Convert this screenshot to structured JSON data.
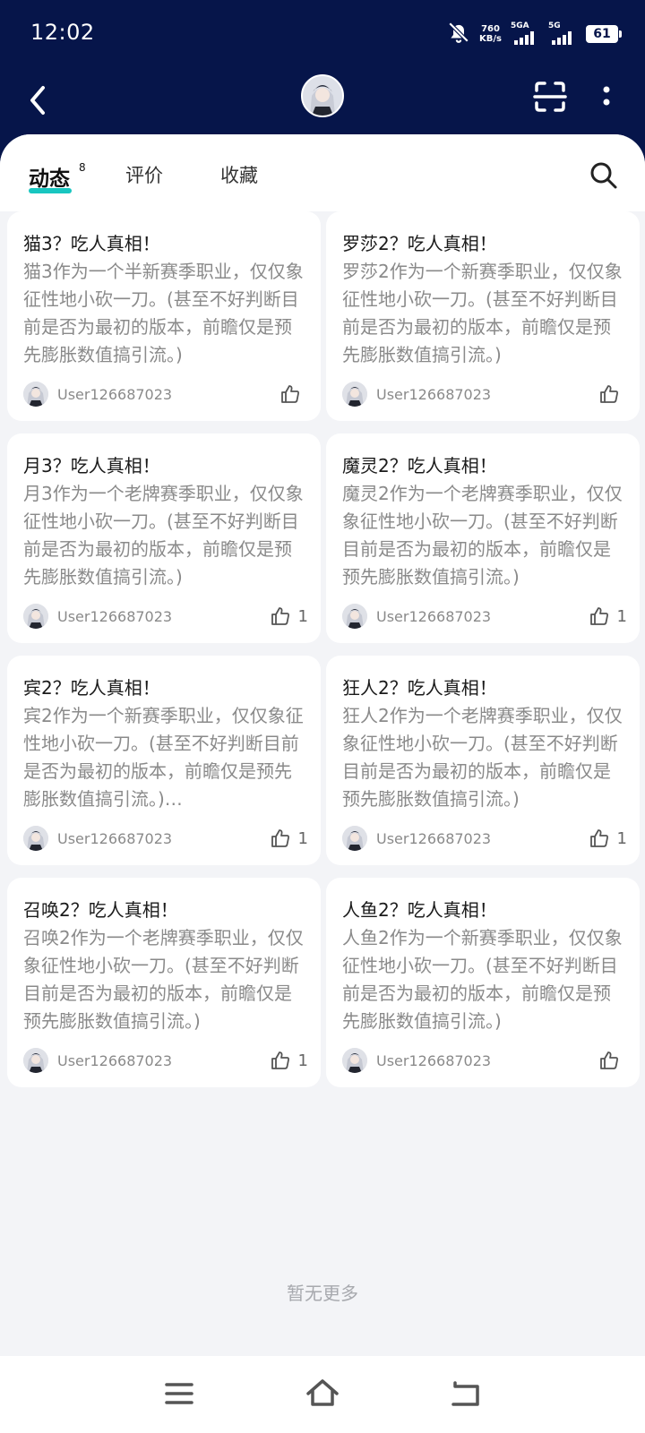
{
  "status_bar": {
    "time": "12:02",
    "speed_value": "760",
    "speed_unit": "KB/s",
    "sim1_label": "5GA",
    "sim2_label": "5G",
    "battery": "61"
  },
  "tabs": [
    {
      "label": "动态",
      "badge": "8",
      "active": true
    },
    {
      "label": "评价",
      "active": false
    },
    {
      "label": "收藏",
      "active": false
    }
  ],
  "posts": [
    {
      "title": "猫3？吃人真相！",
      "body": "猫3作为一个半新赛季职业，仅仅象征性地小砍一刀。(甚至不好判断目前是否为最初的版本，前瞻仅是预先膨胀数值搞引流。)",
      "user": "User126687023",
      "likes": ""
    },
    {
      "title": "罗莎2？吃人真相！",
      "body": "罗莎2作为一个新赛季职业，仅仅象征性地小砍一刀。(甚至不好判断目前是否为最初的版本，前瞻仅是预先膨胀数值搞引流。)",
      "user": "User126687023",
      "likes": ""
    },
    {
      "title": "月3？吃人真相！",
      "body": "月3作为一个老牌赛季职业，仅仅象征性地小砍一刀。(甚至不好判断目前是否为最初的版本，前瞻仅是预先膨胀数值搞引流。)",
      "user": "User126687023",
      "likes": "1"
    },
    {
      "title": "魔灵2？吃人真相！",
      "body": "魔灵2作为一个老牌赛季职业，仅仅象征性地小砍一刀。(甚至不好判断目前是否为最初的版本，前瞻仅是预先膨胀数值搞引流。)",
      "user": "User126687023",
      "likes": "1"
    },
    {
      "title": "宾2？吃人真相！",
      "body": "宾2作为一个新赛季职业，仅仅象征性地小砍一刀。(甚至不好判断目前是否为最初的版本，前瞻仅是预先膨胀数值搞引流。)…",
      "user": "User126687023",
      "likes": "1"
    },
    {
      "title": "狂人2？吃人真相！",
      "body": "狂人2作为一个老牌赛季职业，仅仅象征性地小砍一刀。(甚至不好判断目前是否为最初的版本，前瞻仅是预先膨胀数值搞引流。)",
      "user": "User126687023",
      "likes": "1"
    },
    {
      "title": "召唤2？吃人真相！",
      "body": "召唤2作为一个老牌赛季职业，仅仅象征性地小砍一刀。(甚至不好判断目前是否为最初的版本，前瞻仅是预先膨胀数值搞引流。)",
      "user": "User126687023",
      "likes": "1"
    },
    {
      "title": "人鱼2？吃人真相！",
      "body": "人鱼2作为一个新赛季职业，仅仅象征性地小砍一刀。(甚至不好判断目前是否为最初的版本，前瞻仅是预先膨胀数值搞引流。)",
      "user": "User126687023",
      "likes": ""
    }
  ],
  "footer_text": "暂无更多",
  "colors": {
    "header_bg": "#06154a",
    "accent": "#18c6c0",
    "page_bg": "#f3f4f7"
  },
  "icons": {
    "back": "chevron-left-icon",
    "scan": "scan-icon",
    "more": "more-vertical-icon",
    "search": "search-icon",
    "like": "thumbs-up-icon",
    "mute": "bell-off-icon",
    "menu": "menu-icon",
    "home": "home-icon",
    "back_nav": "return-icon"
  }
}
